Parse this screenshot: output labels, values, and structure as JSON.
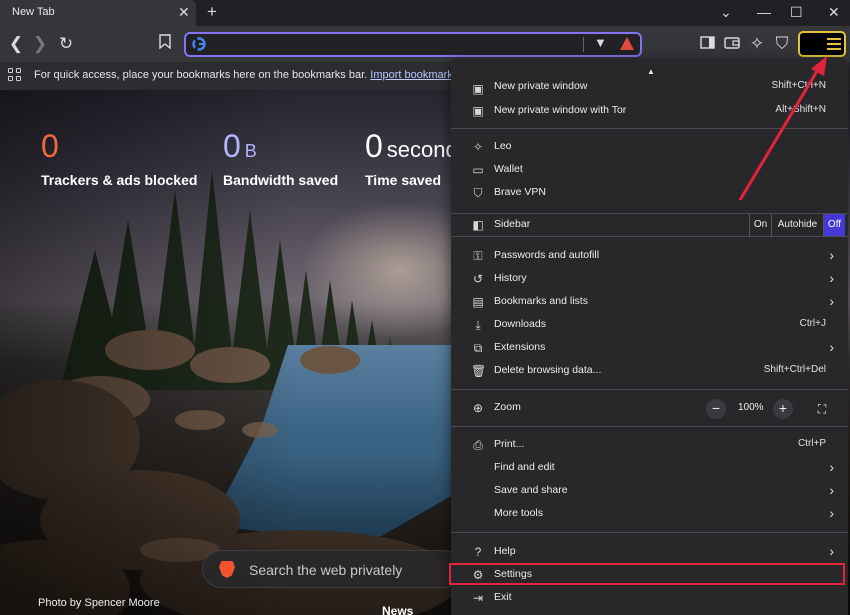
{
  "tab": {
    "title": "New Tab"
  },
  "bookmarks_bar": {
    "text": "For quick access, place your bookmarks here on the bookmarks bar.",
    "link": "Import bookmarks now..."
  },
  "stats": [
    {
      "value": "0",
      "unit": "",
      "label": "Trackers & ads blocked",
      "color": "#f0683f"
    },
    {
      "value": "0",
      "unit": "B",
      "label": "Bandwidth saved",
      "color": "#b6b3ff"
    },
    {
      "value": "0",
      "unit": "seconds",
      "label": "Time saved",
      "color": "#ffffff"
    }
  ],
  "search": {
    "placeholder": "Search the web privately"
  },
  "photo_credit": "Photo by Spencer Moore",
  "news_label": "News",
  "menu": {
    "items": {
      "new_private_window": {
        "label": "New private window",
        "shortcut": "Shift+Ctrl+N"
      },
      "new_private_tor": {
        "label": "New private window with Tor",
        "shortcut": "Alt+Shift+N"
      },
      "leo": {
        "label": "Leo"
      },
      "wallet": {
        "label": "Wallet"
      },
      "vpn": {
        "label": "Brave VPN"
      },
      "sidebar": {
        "label": "Sidebar",
        "options": [
          "On",
          "Autohide",
          "Off"
        ],
        "selected": "Off"
      },
      "passwords": {
        "label": "Passwords and autofill"
      },
      "history": {
        "label": "History"
      },
      "bookmarks": {
        "label": "Bookmarks and lists"
      },
      "downloads": {
        "label": "Downloads",
        "shortcut": "Ctrl+J"
      },
      "extensions": {
        "label": "Extensions"
      },
      "delete_data": {
        "label": "Delete browsing data...",
        "shortcut": "Shift+Ctrl+Del"
      },
      "zoom": {
        "label": "Zoom",
        "value": "100%",
        "minus": "−",
        "plus": "+"
      },
      "print": {
        "label": "Print...",
        "shortcut": "Ctrl+P"
      },
      "find": {
        "label": "Find and edit"
      },
      "save_share": {
        "label": "Save and share"
      },
      "more_tools": {
        "label": "More tools"
      },
      "help": {
        "label": "Help"
      },
      "settings": {
        "label": "Settings"
      },
      "exit": {
        "label": "Exit"
      }
    }
  },
  "colors": {
    "address_border": "#8175f0",
    "highlight": "#e2233a",
    "arrow": "#e2233a",
    "menu_button_border": "#e2c33d"
  }
}
